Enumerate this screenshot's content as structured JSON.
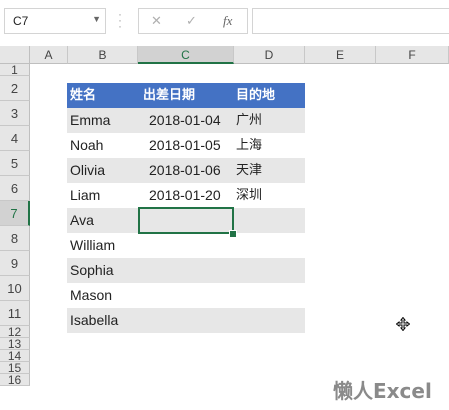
{
  "formula_bar": {
    "name_box": "C7",
    "cancel_icon": "✕",
    "enter_icon": "✓",
    "fx_label": "fx",
    "formula": ""
  },
  "columns": [
    "A",
    "B",
    "C",
    "D",
    "E",
    "F"
  ],
  "rows": [
    "1",
    "2",
    "3",
    "4",
    "5",
    "6",
    "7",
    "8",
    "9",
    "10",
    "11",
    "12",
    "13",
    "14",
    "15",
    "16"
  ],
  "table": {
    "headers": [
      "姓名",
      "出差日期",
      "目的地"
    ],
    "rows": [
      {
        "name": "Emma",
        "date": "2018-01-04",
        "dest": "广州"
      },
      {
        "name": "Noah",
        "date": "2018-01-05",
        "dest": "上海"
      },
      {
        "name": "Olivia",
        "date": "2018-01-06",
        "dest": "天津"
      },
      {
        "name": "Liam",
        "date": "2018-01-20",
        "dest": "深圳"
      },
      {
        "name": "Ava",
        "date": "",
        "dest": ""
      },
      {
        "name": "William",
        "date": "",
        "dest": ""
      },
      {
        "name": "Sophia",
        "date": "",
        "dest": ""
      },
      {
        "name": "Mason",
        "date": "",
        "dest": ""
      },
      {
        "name": "Isabella",
        "date": "",
        "dest": ""
      }
    ]
  },
  "selection": {
    "cell": "C7"
  },
  "watermark": "懒人Excel",
  "colors": {
    "header_fill": "#4472c4",
    "band_fill": "#e7e7e7",
    "selection": "#217346"
  }
}
